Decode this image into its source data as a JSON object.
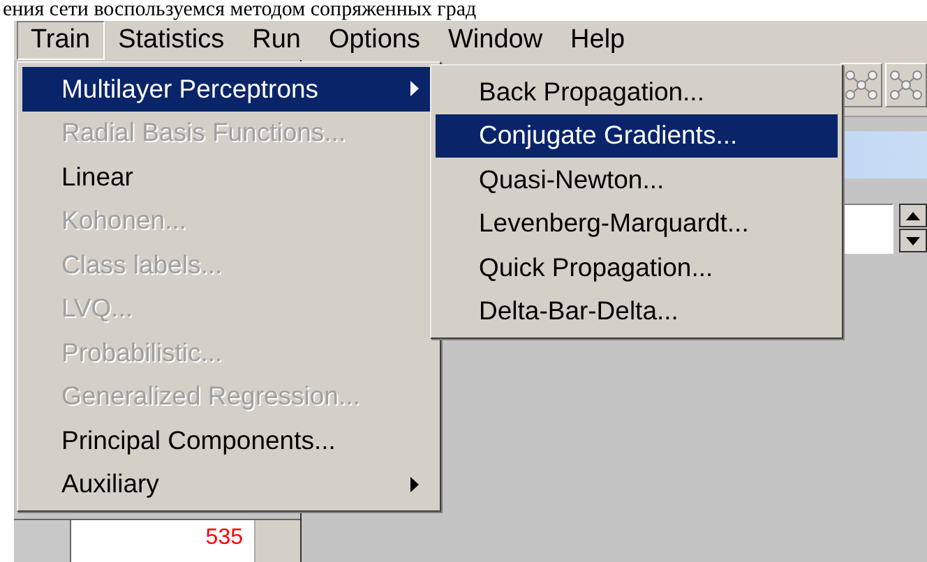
{
  "caption": "ения сети воспользуемся методом сопряженных град",
  "menubar": [
    {
      "label": "Train",
      "selected": true
    },
    {
      "label": "Statistics",
      "selected": false
    },
    {
      "label": "Run",
      "selected": false
    },
    {
      "label": "Options",
      "selected": false
    },
    {
      "label": "Window",
      "selected": false
    },
    {
      "label": "Help",
      "selected": false
    }
  ],
  "menu": [
    {
      "label": "Multilayer Perceptrons",
      "selected": true,
      "disabled": false,
      "has_submenu": true
    },
    {
      "label": "Radial Basis Functions...",
      "selected": false,
      "disabled": true,
      "has_submenu": false
    },
    {
      "label": "Linear",
      "selected": false,
      "disabled": false,
      "has_submenu": false
    },
    {
      "label": "Kohonen...",
      "selected": false,
      "disabled": true,
      "has_submenu": false
    },
    {
      "label": "Class labels...",
      "selected": false,
      "disabled": true,
      "has_submenu": false
    },
    {
      "label": "LVQ...",
      "selected": false,
      "disabled": true,
      "has_submenu": false
    },
    {
      "label": "Probabilistic...",
      "selected": false,
      "disabled": true,
      "has_submenu": false
    },
    {
      "label": "Generalized Regression...",
      "selected": false,
      "disabled": true,
      "has_submenu": false
    },
    {
      "label": "Principal Components...",
      "selected": false,
      "disabled": false,
      "has_submenu": false
    },
    {
      "label": "Auxiliary",
      "selected": false,
      "disabled": false,
      "has_submenu": true
    }
  ],
  "submenu": [
    {
      "label": "Back Propagation...",
      "selected": false
    },
    {
      "label": "Conjugate Gradients...",
      "selected": true
    },
    {
      "label": "Quasi-Newton...",
      "selected": false
    },
    {
      "label": "Levenberg-Marquardt...",
      "selected": false
    },
    {
      "label": "Quick Propagation...",
      "selected": false
    },
    {
      "label": "Delta-Bar-Delta...",
      "selected": false
    }
  ],
  "cell": {
    "value": "535"
  }
}
